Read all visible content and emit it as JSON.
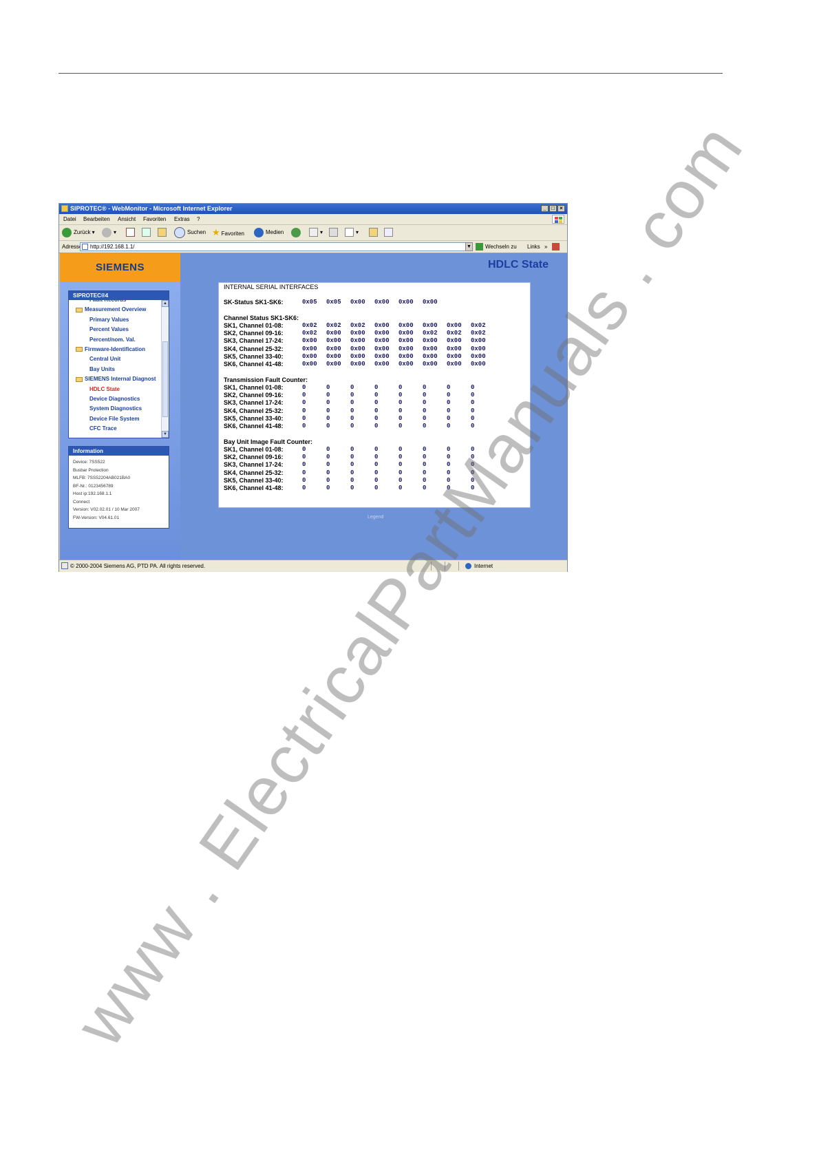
{
  "window": {
    "title": "SIPROTEC® - WebMonitor - Microsoft Internet Explorer",
    "controls": [
      "_",
      "□",
      "×"
    ]
  },
  "menu": [
    "Datei",
    "Bearbeiten",
    "Ansicht",
    "Favoriten",
    "Extras",
    "?"
  ],
  "toolbar": {
    "back": "Zurück",
    "search": "Suchen",
    "favorites": "Favoriten",
    "media": "Medien"
  },
  "address": {
    "label": "Adresse",
    "url": "http://192.168.1.1/",
    "go": "Wechseln zu",
    "links": "Links"
  },
  "sidebar": {
    "logo": "SIEMENS",
    "nav_title": "SIPROTEC®4",
    "items": [
      {
        "label": "Fault Records",
        "type": "sub"
      },
      {
        "label": "Measurement Overview",
        "type": "folder"
      },
      {
        "label": "Primary Values",
        "type": "sub"
      },
      {
        "label": "Percent Values",
        "type": "sub"
      },
      {
        "label": "Percent/nom. Val.",
        "type": "sub"
      },
      {
        "label": "Firmware-Identification",
        "type": "folder"
      },
      {
        "label": "Central Unit",
        "type": "sub"
      },
      {
        "label": "Bay Units",
        "type": "sub"
      },
      {
        "label": "SIEMENS Internal Diagnost",
        "type": "folder"
      },
      {
        "label": "HDLC State",
        "type": "active"
      },
      {
        "label": "Device Diagnostics",
        "type": "sub"
      },
      {
        "label": "System Diagnostics",
        "type": "sub"
      },
      {
        "label": "Device File System",
        "type": "sub"
      },
      {
        "label": "CFC Trace",
        "type": "sub"
      }
    ],
    "info_title": "Information",
    "info": [
      "Device: 7SS522",
      "Busbar Protection",
      "MLFB: 7SS52204AB021BA0",
      "BF-Nr.: 0123456789",
      "Host ip:192.168.1.1",
      "Connect",
      "Version: V02.02.01 / 10 Mar 2007",
      "FW-Version: V04.61.01"
    ]
  },
  "page": {
    "title": "HDLC State",
    "heading": "INTERNAL SERIAL INTERFACES",
    "sk_status_label": "SK-Status SK1-SK6:",
    "sk_status": [
      "0x05",
      "0x05",
      "0x00",
      "0x00",
      "0x00",
      "0x00"
    ],
    "channel_title": "Channel Status SK1-SK6:",
    "row_labels": [
      "SK1, Channel 01-08:",
      "SK2, Channel 09-16:",
      "SK3, Channel 17-24:",
      "SK4, Channel 25-32:",
      "SK5, Channel 33-40:",
      "SK6, Channel 41-48:"
    ],
    "channel_rows": [
      [
        "0x02",
        "0x02",
        "0x02",
        "0x00",
        "0x00",
        "0x00",
        "0x00",
        "0x02"
      ],
      [
        "0x02",
        "0x00",
        "0x00",
        "0x00",
        "0x00",
        "0x02",
        "0x02",
        "0x02"
      ],
      [
        "0x00",
        "0x00",
        "0x00",
        "0x00",
        "0x00",
        "0x00",
        "0x00",
        "0x00"
      ],
      [
        "0x00",
        "0x00",
        "0x00",
        "0x00",
        "0x00",
        "0x00",
        "0x00",
        "0x00"
      ],
      [
        "0x00",
        "0x00",
        "0x00",
        "0x00",
        "0x00",
        "0x00",
        "0x00",
        "0x00"
      ],
      [
        "0x00",
        "0x00",
        "0x00",
        "0x00",
        "0x00",
        "0x00",
        "0x00",
        "0x00"
      ]
    ],
    "tx_title": "Transmission Fault Counter:",
    "tx_rows": [
      [
        "0",
        "0",
        "0",
        "0",
        "0",
        "0",
        "0",
        "0"
      ],
      [
        "0",
        "0",
        "0",
        "0",
        "0",
        "0",
        "0",
        "0"
      ],
      [
        "0",
        "0",
        "0",
        "0",
        "0",
        "0",
        "0",
        "0"
      ],
      [
        "0",
        "0",
        "0",
        "0",
        "0",
        "0",
        "0",
        "0"
      ],
      [
        "0",
        "0",
        "0",
        "0",
        "0",
        "0",
        "0",
        "0"
      ],
      [
        "0",
        "0",
        "0",
        "0",
        "0",
        "0",
        "0",
        "0"
      ]
    ],
    "bay_title": "Bay Unit Image Fault Counter:",
    "bay_rows": [
      [
        "0",
        "0",
        "0",
        "0",
        "0",
        "0",
        "0",
        "0"
      ],
      [
        "0",
        "0",
        "0",
        "0",
        "0",
        "0",
        "0",
        "0"
      ],
      [
        "0",
        "0",
        "0",
        "0",
        "0",
        "0",
        "0",
        "0"
      ],
      [
        "0",
        "0",
        "0",
        "0",
        "0",
        "0",
        "0",
        "0"
      ],
      [
        "0",
        "0",
        "0",
        "0",
        "0",
        "0",
        "0",
        "0"
      ],
      [
        "0",
        "0",
        "0",
        "0",
        "0",
        "0",
        "0",
        "0"
      ]
    ],
    "legend": "Legend"
  },
  "status": {
    "text": "© 2000-2004 Siemens AG, PTD PA. All rights reserved.",
    "zone": "Internet"
  },
  "watermark": "www . ElectricalPartManuals . com",
  "colors": {
    "accent_orange": "#f59c1a",
    "nav_blue": "#1a3fa0",
    "active_red": "#d8261a"
  }
}
